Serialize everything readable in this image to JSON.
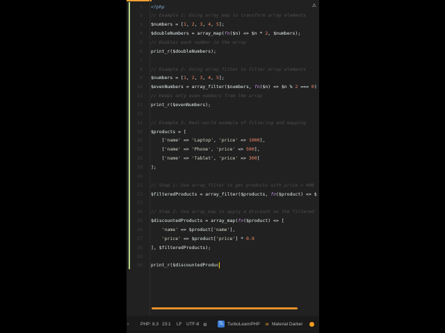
{
  "editor": {
    "lines": [
      [
        [
          "<?php",
          "t"
        ]
      ],
      [
        [
          "// Example 1: Using array_map to transform array elements",
          "c"
        ]
      ],
      [
        [
          "$numbers = [",
          ""
        ],
        [
          "1",
          "n"
        ],
        [
          ", ",
          ""
        ],
        [
          "2",
          "n"
        ],
        [
          ", ",
          ""
        ],
        [
          "3",
          "n"
        ],
        [
          ", ",
          ""
        ],
        [
          "4",
          "n"
        ],
        [
          ", ",
          ""
        ],
        [
          "5",
          "n"
        ],
        [
          "];",
          ""
        ]
      ],
      [
        [
          "$doubleNumbers = array_map(",
          ""
        ],
        [
          "fn",
          "k"
        ],
        [
          "($n) => $n * ",
          ""
        ],
        [
          "2",
          "n"
        ],
        [
          ", $numbers);",
          ""
        ]
      ],
      [
        [
          "// Doubles each number in the array",
          "c"
        ]
      ],
      [
        [
          "print_r($doubleNumbers);",
          ""
        ]
      ],
      [],
      [
        [
          "// Example 2: Using array_filter to filter array elements",
          "c"
        ]
      ],
      [
        [
          "$numbers = [",
          ""
        ],
        [
          "1",
          "n"
        ],
        [
          ", ",
          ""
        ],
        [
          "2",
          "n"
        ],
        [
          ", ",
          ""
        ],
        [
          "3",
          "n"
        ],
        [
          ", ",
          ""
        ],
        [
          "4",
          "n"
        ],
        [
          ", ",
          ""
        ],
        [
          "5",
          "n"
        ],
        [
          "];",
          ""
        ]
      ],
      [
        [
          "$evenNumbers = array_filter($numbers, ",
          ""
        ],
        [
          "fn",
          "k"
        ],
        [
          "($n) => $n % ",
          ""
        ],
        [
          "2",
          "n"
        ],
        [
          " === ",
          ""
        ],
        [
          "0",
          "n"
        ],
        [
          ")",
          ""
        ]
      ],
      [
        [
          "// Keeps only even numbers from the array",
          "c"
        ]
      ],
      [
        [
          "print_r($evenNumbers);",
          ""
        ]
      ],
      [],
      [
        [
          "// Example 3: Real-world example of filtering and mapping",
          "c"
        ]
      ],
      [
        [
          "$products = [",
          ""
        ]
      ],
      [
        [
          "    [",
          ""
        ],
        [
          "'name'",
          "s"
        ],
        [
          " => ",
          ""
        ],
        [
          "'Laptop'",
          "s"
        ],
        [
          ", ",
          ""
        ],
        [
          "'price'",
          "s"
        ],
        [
          " => ",
          ""
        ],
        [
          "1000",
          "n"
        ],
        [
          "],",
          ""
        ]
      ],
      [
        [
          "    [",
          ""
        ],
        [
          "'name'",
          "s"
        ],
        [
          " => ",
          ""
        ],
        [
          "'Phone'",
          "s"
        ],
        [
          ", ",
          ""
        ],
        [
          "'price'",
          "s"
        ],
        [
          " => ",
          ""
        ],
        [
          "500",
          "n"
        ],
        [
          "],",
          ""
        ]
      ],
      [
        [
          "    [",
          ""
        ],
        [
          "'name'",
          "s"
        ],
        [
          " => ",
          ""
        ],
        [
          "'Tablet'",
          "s"
        ],
        [
          ", ",
          ""
        ],
        [
          "'price'",
          "s"
        ],
        [
          " => ",
          ""
        ],
        [
          "300",
          "n"
        ],
        [
          "]",
          ""
        ]
      ],
      [
        [
          "];",
          ""
        ]
      ],
      [],
      [
        [
          "// Step 1: Use array_filter to get products with price > 400",
          "c"
        ]
      ],
      [
        [
          "$filteredProducts = array_filter($products, ",
          ""
        ],
        [
          "fn",
          "k"
        ],
        [
          "($product) => $",
          ""
        ]
      ],
      [],
      [
        [
          "// Step 2: Use array_map to apply a discount on the filtered",
          "c"
        ]
      ],
      [
        [
          "$discountedProducts = array_map(",
          ""
        ],
        [
          "fn",
          "k"
        ],
        [
          "($product) => [",
          ""
        ]
      ],
      [
        [
          "    ",
          ""
        ],
        [
          "'name'",
          "s"
        ],
        [
          " => $product[",
          ""
        ],
        [
          "'name'",
          "s"
        ],
        [
          "],",
          ""
        ]
      ],
      [
        [
          "    ",
          ""
        ],
        [
          "'price'",
          "s"
        ],
        [
          " => $product[",
          ""
        ],
        [
          "'price'",
          "s"
        ],
        [
          "] * ",
          ""
        ],
        [
          "0.9",
          "n"
        ]
      ],
      [
        [
          "], $filteredProducts);",
          ""
        ]
      ],
      [],
      [
        [
          "print_r($discountedProduc",
          ""
        ]
      ]
    ],
    "warning_icon": "warning-icon"
  },
  "status": {
    "php": "PHP: 8.3",
    "position": "23:1",
    "eol": "LF",
    "encoding": "UTF-8",
    "plugin_badge": "TL",
    "plugin": "TurboLearnPHP",
    "theme": "Material Darker"
  },
  "colors": {
    "accent": "#f39a1e",
    "git_added": "#b9d88a",
    "plugin_badge": "#3a7bd5"
  }
}
